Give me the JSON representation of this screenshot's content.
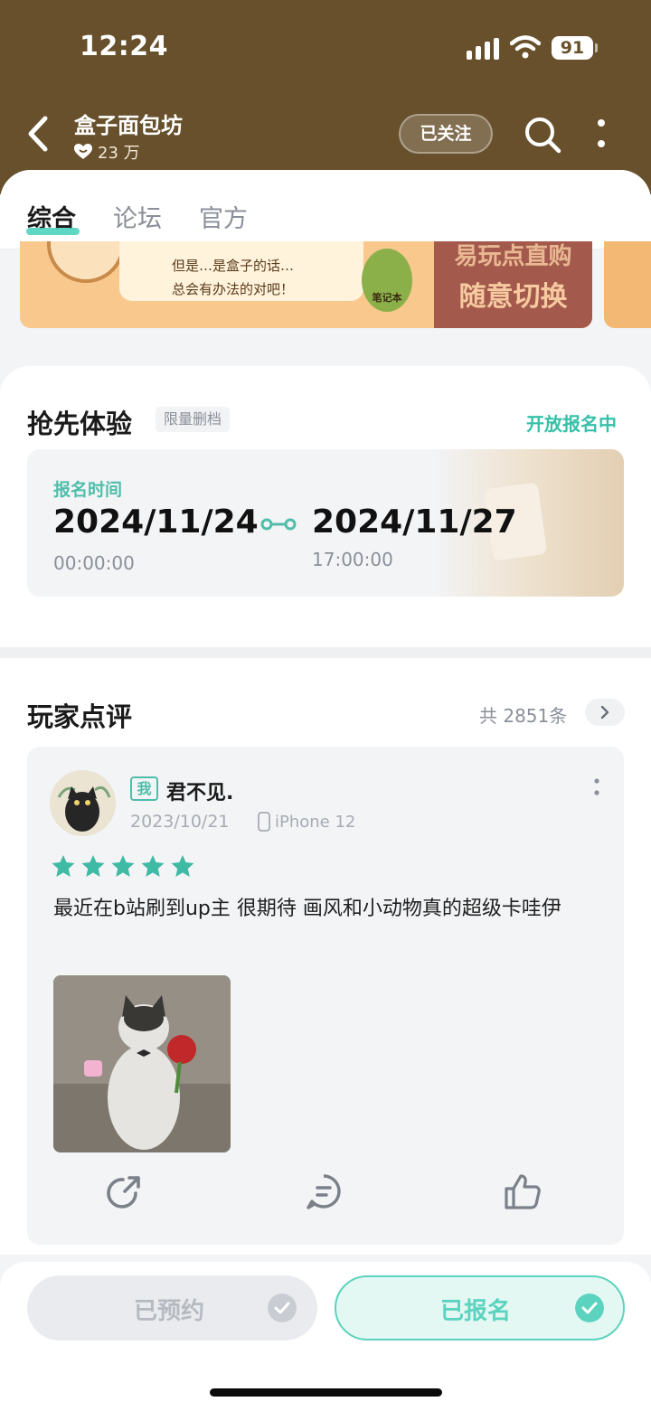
{
  "status_bar": {
    "time": "12:24",
    "battery": "91"
  },
  "header": {
    "title": "盒子面包坊",
    "followers": "23 万",
    "follow_label": "已关注"
  },
  "tabs": [
    {
      "label": "综合",
      "active": true
    },
    {
      "label": "论坛",
      "active": false
    },
    {
      "label": "官方",
      "active": false
    }
  ],
  "banner": {
    "speech_line1": "但是…是盒子的话…",
    "speech_line2": "总会有办法的对吧！",
    "badge_text": "笔记本",
    "headline_line1": "易玩点直购",
    "headline_line2": "随意切换"
  },
  "early_access": {
    "title": "抢先体验",
    "tag": "限量删档",
    "status": "开放报名中",
    "reg_label": "报名时间",
    "start_date": "2024/11/24",
    "start_time": "00:00:00",
    "end_date": "2024/11/27",
    "end_time": "17:00:00"
  },
  "reviews": {
    "title": "玩家点评",
    "count": "共 2851条",
    "items": [
      {
        "me_badge": "我",
        "user": "君不见.",
        "date": "2023/10/21",
        "device": "iPhone 12",
        "stars": 5,
        "text": "最近在b站刷到up主  很期待 画风和小动物真的超级卡哇伊"
      }
    ]
  },
  "bottom": {
    "reserved_label": "已预约",
    "registered_label": "已报名"
  },
  "colors": {
    "header_bg": "#67502b",
    "accent": "#4fd3be",
    "accent_text": "#36c0a8"
  },
  "icons": [
    "back-icon",
    "search-icon",
    "more-icon",
    "heart-icon",
    "star-icon",
    "share-icon",
    "comment-icon",
    "like-icon",
    "check-icon",
    "phone-icon"
  ]
}
